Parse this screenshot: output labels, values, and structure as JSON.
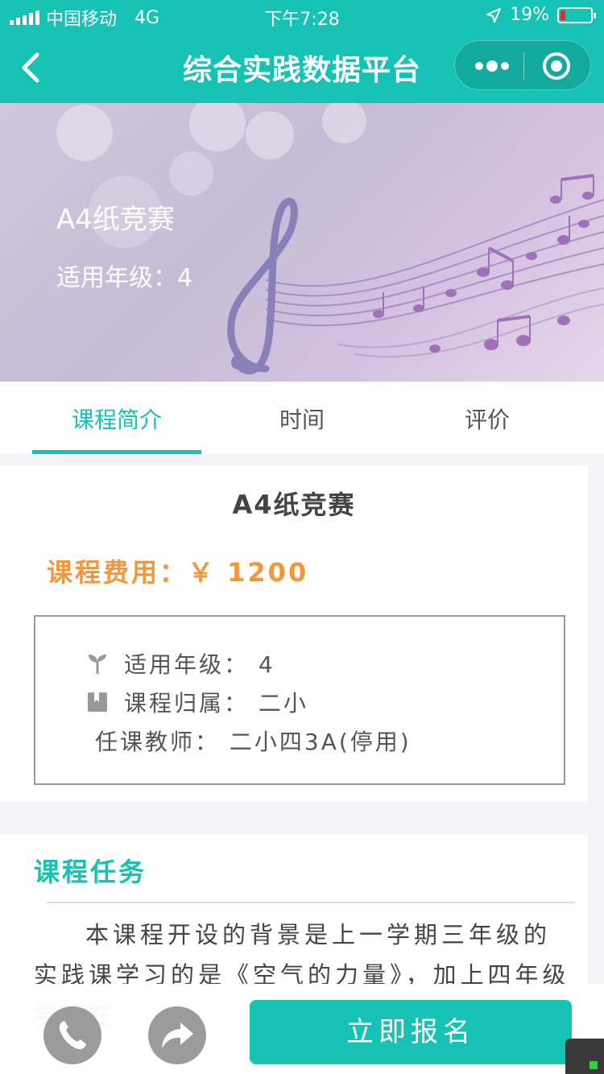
{
  "status_bar": {
    "carrier": "中国移动",
    "network": "4G",
    "time": "下午7:28",
    "battery": "19%",
    "colors": {
      "battery_low": "#e8262c"
    }
  },
  "nav": {
    "title": "综合实践数据平台",
    "icons": [
      "chevron-left-icon",
      "more-dots-icon",
      "target-icon"
    ]
  },
  "banner": {
    "title": "A4纸竞赛",
    "grade": "适用年级：4"
  },
  "tabs": [
    {
      "label": "课程简介",
      "active": true
    },
    {
      "label": "时间",
      "active": false
    },
    {
      "label": "评价",
      "active": false
    }
  ],
  "course": {
    "title": "A4纸竞赛",
    "fee": "课程费用：￥ 1200",
    "info": {
      "grade": "适用年级：  4",
      "belongs": "课程归属：  二小",
      "teacher": "任课教师：  二小四3A(停用)"
    }
  },
  "task": {
    "title": "课程任务",
    "text": "本课程开设的背景是上一学期三年级的实践课学习的是《空气的力量》，加上四年级学生在"
  },
  "bottom_bar": {
    "signup_label": "立即报名",
    "icons": [
      "phone-icon",
      "share-icon"
    ]
  },
  "theme": {
    "accent": "#15c2b4",
    "fee_color": "#f5963a"
  }
}
